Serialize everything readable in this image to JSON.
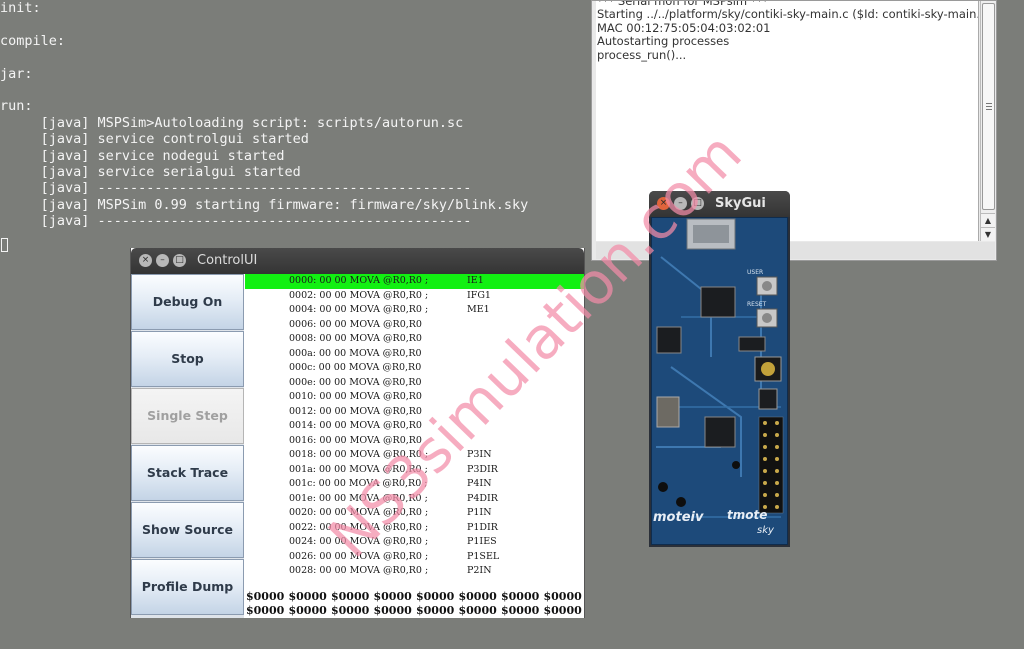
{
  "terminal": {
    "lines": [
      "init:",
      "",
      "compile:",
      "",
      "jar:",
      "",
      "run:",
      "     [java] MSPSim>Autoloading script: scripts/autorun.sc",
      "     [java] service controlgui started",
      "     [java] service nodegui started",
      "     [java] service serialgui started",
      "     [java] ----------------------------------------------",
      "     [java] MSPSim 0.99 starting firmware: firmware/sky/blink.sky",
      "     [java] ----------------------------------------------"
    ]
  },
  "serial": {
    "lines": [
      "*** Serial mon for MSPsim ***",
      "Starting ../../platform/sky/contiki-sky-main.c ($Id: contiki-sky-main.c,v",
      "MAC 00:12:75:05:04:03:02:01",
      "Autostarting processes",
      "process_run()..."
    ],
    "scroll_up": "▲",
    "scroll_down": "▼"
  },
  "controlui": {
    "title": "ControlUI",
    "buttons": {
      "debug_on": "Debug On",
      "stop": "Stop",
      "single_step": "Single Step",
      "stack_trace": "Stack Trace",
      "show_source": "Show Source",
      "profile_dump": "Profile Dump"
    },
    "code_rows": [
      {
        "addr": "0000: 00 00 MOVA @R0,R0 ;",
        "label": "IE1"
      },
      {
        "addr": "0002: 00 00 MOVA @R0,R0 ;",
        "label": "IFG1"
      },
      {
        "addr": "0004: 00 00 MOVA @R0,R0 ;",
        "label": "ME1"
      },
      {
        "addr": "0006: 00 00 MOVA @R0,R0",
        "label": ""
      },
      {
        "addr": "0008: 00 00 MOVA @R0,R0",
        "label": ""
      },
      {
        "addr": "000a: 00 00 MOVA @R0,R0",
        "label": ""
      },
      {
        "addr": "000c: 00 00 MOVA @R0,R0",
        "label": ""
      },
      {
        "addr": "000e: 00 00 MOVA @R0,R0",
        "label": ""
      },
      {
        "addr": "0010: 00 00 MOVA @R0,R0",
        "label": ""
      },
      {
        "addr": "0012: 00 00 MOVA @R0,R0",
        "label": ""
      },
      {
        "addr": "0014: 00 00 MOVA @R0,R0",
        "label": ""
      },
      {
        "addr": "0016: 00 00 MOVA @R0,R0",
        "label": ""
      },
      {
        "addr": "0018: 00 00 MOVA @R0,R0 ;",
        "label": "P3IN"
      },
      {
        "addr": "001a: 00 00 MOVA @R0,R0 ;",
        "label": "P3DIR"
      },
      {
        "addr": "001c: 00 00 MOVA @R0,R0 ;",
        "label": "P4IN"
      },
      {
        "addr": "001e: 00 00 MOVA @R0,R0 ;",
        "label": "P4DIR"
      },
      {
        "addr": "0020: 00 00 MOVA @R0,R0 ;",
        "label": "P1IN"
      },
      {
        "addr": "0022: 00 00 MOVA @R0,R0 ;",
        "label": "P1DIR"
      },
      {
        "addr": "0024: 00 00 MOVA @R0,R0 ;",
        "label": "P1IES"
      },
      {
        "addr": "0026: 00 00 MOVA @R0,R0 ;",
        "label": "P1SEL"
      },
      {
        "addr": "0028: 00 00 MOVA @R0,R0 ;",
        "label": "P2IN"
      }
    ],
    "registers": [
      [
        "$0000",
        "$0000",
        "$0000",
        "$0000",
        "$0000",
        "$0000",
        "$0000",
        "$0000"
      ],
      [
        "$0000",
        "$0000",
        "$0000",
        "$0000",
        "$0000",
        "$0000",
        "$0000",
        "$0000"
      ]
    ]
  },
  "skygui": {
    "title": "SkyGui",
    "board_labels": {
      "user": "USER",
      "reset": "RESET",
      "brand_left": "moteiv",
      "brand_right": "tmote",
      "brand_sub": "sky"
    }
  },
  "window_buttons": {
    "close": "×",
    "minimize": "–",
    "maximize": "□"
  },
  "watermark": "NS3simulation.com",
  "colors": {
    "desktop": "#7b7d79",
    "highlight_row": "#12f012",
    "watermark": "#f28ca8",
    "board": "#1d4a7a"
  }
}
